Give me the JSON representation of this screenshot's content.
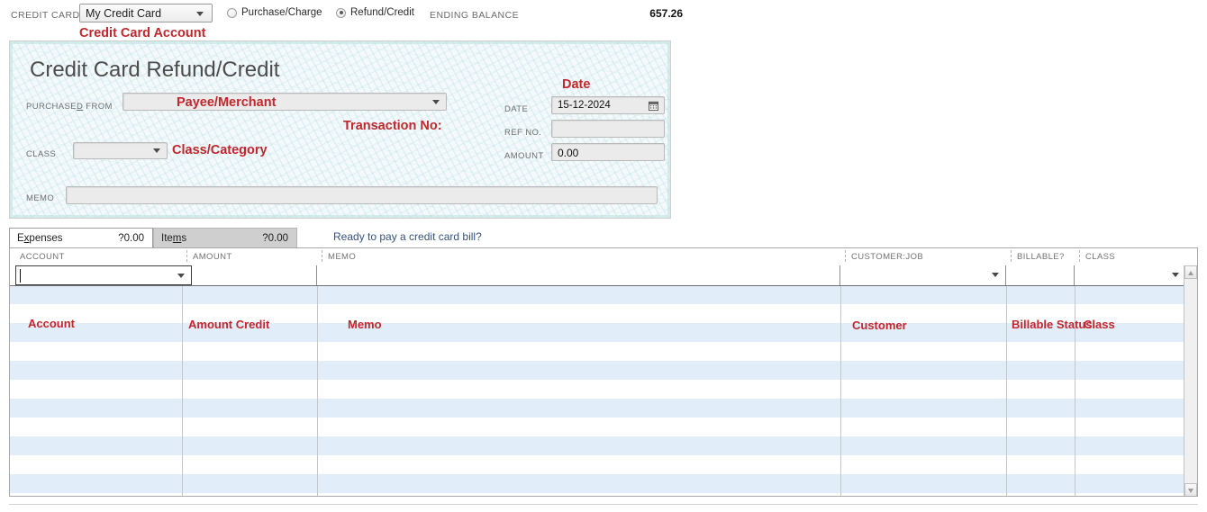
{
  "topbar": {
    "credit_card_label": "CREDIT CARD",
    "account_value": "My Credit Card",
    "radio_purchase": "Purchase/Charge",
    "radio_refund": "Refund/Credit",
    "selected_radio": "Refund/Credit",
    "ending_balance_label": "ENDING BALANCE",
    "ending_balance_value": "657.26",
    "annotation_account": "Credit Card Account"
  },
  "check": {
    "title": "Credit Card Refund/Credit",
    "purchased_from_label": "PURCHASED FROM",
    "purchased_from_value": "",
    "class_label": "CLASS",
    "class_value": "",
    "memo_label": "MEMO",
    "memo_value": "",
    "date_label": "DATE",
    "date_value": "15-12-2024",
    "ref_no_label": "REF NO.",
    "ref_no_value": "",
    "amount_label": "AMOUNT",
    "amount_value": "0.00",
    "annotations": {
      "payee": "Payee/Merchant",
      "class": "Class/Category",
      "date": "Date",
      "transaction_no": "Transaction No:"
    },
    "calendar_icon": "calendar-icon"
  },
  "tabs": {
    "expenses_label": "Expenses",
    "expenses_amount": "?0.00",
    "items_label": "Items",
    "items_amount": "?0.00",
    "active_tab": "Expenses",
    "bill_link": "Ready to pay a credit card bill?"
  },
  "grid": {
    "columns": [
      "ACCOUNT",
      "AMOUNT",
      "MEMO",
      "CUSTOMER:JOB",
      "BILLABLE?",
      "CLASS"
    ],
    "active_row": {
      "account": "",
      "amount": "",
      "memo": "",
      "customer_job": "",
      "billable": "",
      "class": ""
    },
    "annotations": {
      "account": "Account",
      "amount": "Amount Credit",
      "memo": "Memo",
      "customer": "Customer",
      "billable": "Billable Status",
      "class": "Class"
    }
  },
  "colors": {
    "annotation_red": "#c1272d",
    "link_blue": "#36527f",
    "zebra_blue": "#e2edfa",
    "check_paper": "#f4fafb"
  }
}
